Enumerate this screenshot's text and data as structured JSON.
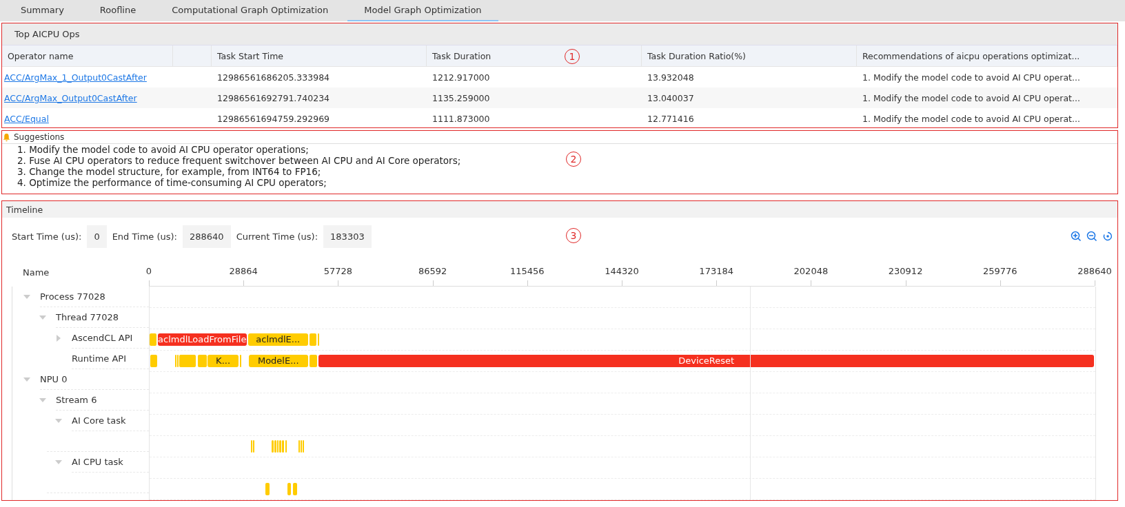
{
  "tabs": [
    {
      "label": "Summary",
      "selected": false
    },
    {
      "label": "Roofline",
      "selected": false
    },
    {
      "label": "Computational Graph Optimization",
      "selected": false
    },
    {
      "label": "Model Graph Optimization",
      "selected": true
    }
  ],
  "top_aicpu_ops": {
    "title": "Top AICPU Ops",
    "callout": "1",
    "columns": [
      "Operator name",
      "",
      "Task Start Time",
      "Task Duration",
      "Task Duration Ratio(%)",
      "Recommendations of aicpu operations optimizat..."
    ],
    "rows": [
      [
        "ACC/ArgMax_1_Output0CastAfter",
        "",
        "12986561686205.333984",
        "1212.917000",
        "13.932048",
        "1. Modify the model code to avoid AI CPU operat..."
      ],
      [
        "ACC/ArgMax_Output0CastAfter",
        "",
        "12986561692791.740234",
        "1135.259000",
        "13.040037",
        "1. Modify the model code to avoid AI CPU operat..."
      ],
      [
        "ACC/Equal",
        "",
        "12986561694759.292969",
        "1111.873000",
        "12.771416",
        "1. Modify the model code to avoid AI CPU operat..."
      ]
    ]
  },
  "suggestions": {
    "title": "Suggestions",
    "callout": "2",
    "items": [
      "1. Modify the model code to avoid AI CPU operator operations;",
      "2. Fuse AI CPU operators to reduce frequent switchover between AI CPU and AI Core operators;",
      "3. Change the model structure, for example, from INT64 to FP16;",
      "4. Optimize the performance of time-consuming AI CPU operators;"
    ]
  },
  "timeline": {
    "title": "Timeline",
    "callout": "3",
    "start_label": "Start Time (us):",
    "start_value": "0",
    "end_label": "End Time (us):",
    "end_value": "288640",
    "current_label": "Current Time (us):",
    "current_value": "183303",
    "name_header": "Name",
    "ticks": [
      "0",
      "28864",
      "57728",
      "86592",
      "115456",
      "144320",
      "173184",
      "202048",
      "230912",
      "259776",
      "288640"
    ],
    "tracks": [
      {
        "name": "Process 77028",
        "expanded": true,
        "children": [
          {
            "name": "Thread 77028",
            "expanded": true,
            "children": [
              {
                "name": "AscendCL API",
                "expanded": false,
                "bars": [
                  {
                    "label": "aclmdlLoadFromFile",
                    "color": "#f5301f"
                  },
                  {
                    "label": "aclmdlE...",
                    "color": "#ffcc00"
                  }
                ]
              },
              {
                "name": "Runtime API",
                "bars": [
                  {
                    "label": "K...",
                    "color": "#ffcc00"
                  },
                  {
                    "label": "ModelE...",
                    "color": "#ffcc00"
                  },
                  {
                    "label": "DeviceReset",
                    "color": "#f5301f"
                  }
                ]
              }
            ]
          }
        ]
      },
      {
        "name": "NPU 0",
        "expanded": true,
        "children": [
          {
            "name": "Stream 6",
            "expanded": true,
            "children": [
              {
                "name": "AI Core task",
                "expanded": true,
                "children": [
                  {
                    "kind": "lane"
                  }
                ]
              },
              {
                "name": "AI CPU task",
                "expanded": true,
                "children": [
                  {
                    "kind": "lane"
                  }
                ]
              }
            ]
          }
        ]
      }
    ]
  }
}
